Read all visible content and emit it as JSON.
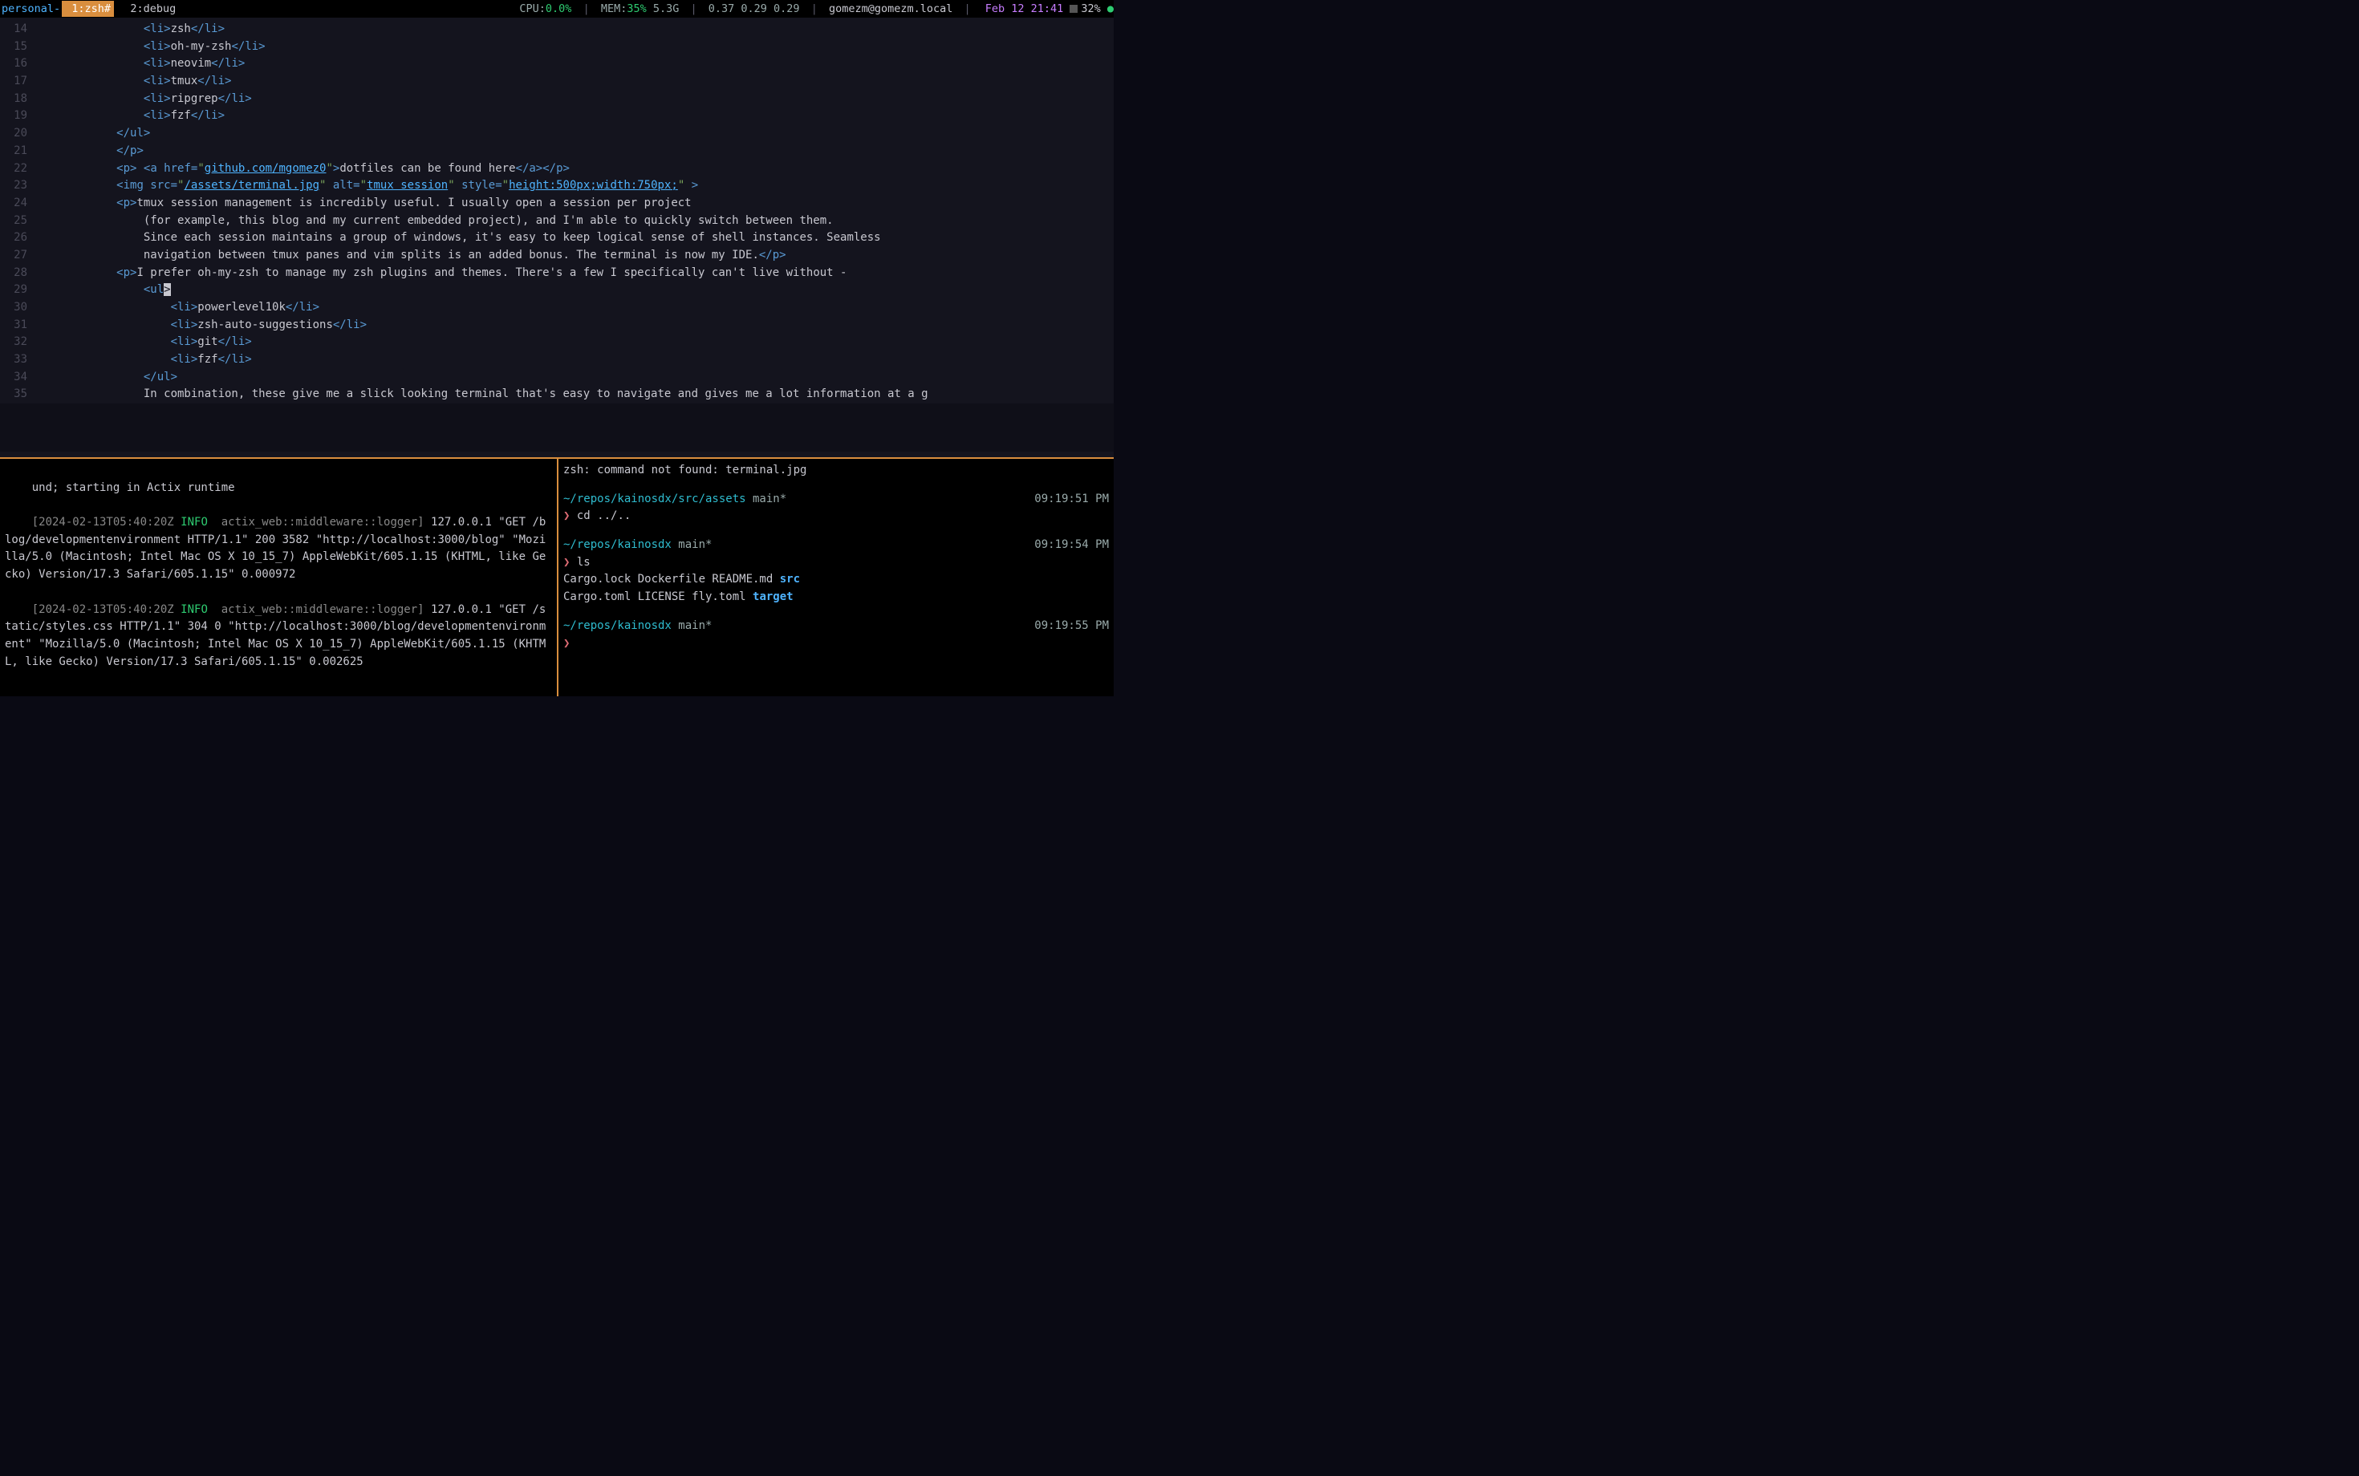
{
  "status": {
    "session": "personal-",
    "win_active": " 1:zsh#",
    "win_inactive": "2:debug",
    "cpu_label": "CPU:",
    "cpu_value": "0.0%",
    "mem_label": "MEM:",
    "mem_value": "35%",
    "mem_abs": " 5.3G",
    "load": "0.37 0.29 0.29",
    "userhost": "gomezm@gomezm.local",
    "datetime": "Feb 12 21:41",
    "battery": "32%",
    "sep": " | "
  },
  "editor": {
    "lines": [
      {
        "n": "14",
        "code": "                <li>zsh</li>"
      },
      {
        "n": "15",
        "code": "                <li>oh-my-zsh</li>"
      },
      {
        "n": "16",
        "code": "                <li>neovim</li>"
      },
      {
        "n": "17",
        "code": "                <li>tmux</li>"
      },
      {
        "n": "18",
        "code": "                <li>ripgrep</li>"
      },
      {
        "n": "19",
        "code": "                <li>fzf</li>"
      },
      {
        "n": "20",
        "code": "            </ul>"
      },
      {
        "n": "21",
        "code": "            </p>"
      },
      {
        "n": "22",
        "code": "            <p> <a href=\"github.com/mgomez0\">dotfiles can be found here</a></p>"
      },
      {
        "n": "23",
        "code": "            <img src=\"/assets/terminal.jpg\" alt=\"tmux session\" style=\"height:500px;width:750px;\" >"
      },
      {
        "n": "24",
        "code": "            <p>tmux session management is incredibly useful. I usually open a session per project"
      },
      {
        "n": "25",
        "code": "                (for example, this blog and my current embedded project), and I'm able to quickly switch between them."
      },
      {
        "n": "26",
        "code": "                Since each session maintains a group of windows, it's easy to keep logical sense of shell instances. Seamless"
      },
      {
        "n": "27",
        "code": "                navigation between tmux panes and vim splits is an added bonus. The terminal is now my IDE.</p>"
      },
      {
        "n": "28",
        "code": "            <p>I prefer oh-my-zsh to manage my zsh plugins and themes. There's a few I specifically can't live without -"
      },
      {
        "n": "29",
        "code": "                <ul>"
      },
      {
        "n": "30",
        "code": "                    <li>powerlevel10k</li>"
      },
      {
        "n": "31",
        "code": "                    <li>zsh-auto-suggestions</li>"
      },
      {
        "n": "32",
        "code": "                    <li>git</li>"
      },
      {
        "n": "33",
        "code": "                    <li>fzf</li>"
      },
      {
        "n": "34",
        "code": "                </ul>"
      },
      {
        "n": "35",
        "code": "                In combination, these give me a slick looking terminal that's easy to navigate and gives me a lot information at a g"
      }
    ]
  },
  "left_pane": {
    "l1": "und; starting in Actix runtime",
    "ts1": "[2024-02-13T05:40:20Z ",
    "info": "INFO",
    "mod": "  actix_web::middleware::logger]",
    "req1": " 127.0.0.1 \"GET /blog/developmentenvironment HTTP/1.1\" 200 3582 \"http://localhost:3000/blog\" \"Mozilla/5.0 (Macintosh; Intel Mac OS X 10_15_7) AppleWebKit/605.1.15 (KHTML, like Gecko) Version/17.3 Safari/605.1.15\" 0.000972",
    "ts2": "[2024-02-13T05:40:20Z ",
    "req2": " 127.0.0.1 \"GET /static/styles.css HTTP/1.1\" 304 0 \"http://localhost:3000/blog/developmentenvironment\" \"Mozilla/5.0 (Macintosh; Intel Mac OS X 10_15_7) AppleWebKit/605.1.15 (KHTML, like Gecko) Version/17.3 Safari/605.1.15\" 0.002625"
  },
  "right_pane": {
    "err": "zsh: command not found: terminal.jpg",
    "p1_path": "~/repos/kainosdx/src/assets",
    "p1_branch": " main*",
    "p1_time": "09:19:51 PM",
    "p1_cmd": "cd ../..",
    "p2_path": "~/repos/kainosdx",
    "p2_branch": " main*",
    "p2_time": "09:19:54 PM",
    "p2_cmd": "ls",
    "ls1a": "Cargo.lock Dockerfile README.md  ",
    "ls1b": "src",
    "ls2a": "Cargo.toml LICENSE    fly.toml   ",
    "ls2b": "target",
    "p3_path": "~/repos/kainosdx",
    "p3_branch": " main*",
    "p3_time": "09:19:55 PM",
    "caret": "❯"
  }
}
